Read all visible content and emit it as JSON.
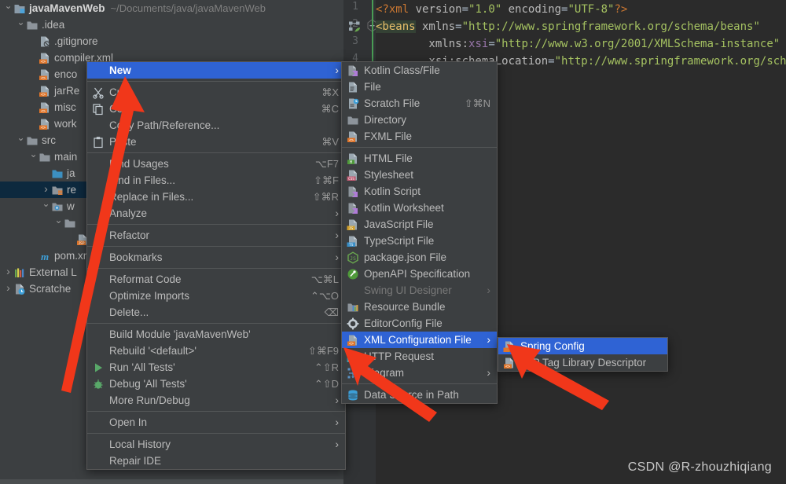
{
  "project_tree": {
    "rows": [
      {
        "indent": 0,
        "arrow": "down",
        "icon": "module-icon",
        "label": "javaMavenWeb",
        "bold": true,
        "path": "~/Documents/java/javaMavenWeb"
      },
      {
        "indent": 1,
        "arrow": "down",
        "icon": "folder-icon",
        "label": ".idea"
      },
      {
        "indent": 2,
        "arrow": "none",
        "icon": "gitignore-icon",
        "label": ".gitignore"
      },
      {
        "indent": 2,
        "arrow": "none",
        "icon": "xml-file-icon",
        "label": "compiler.xml"
      },
      {
        "indent": 2,
        "arrow": "none",
        "icon": "xml-file-icon",
        "label": "enco"
      },
      {
        "indent": 2,
        "arrow": "none",
        "icon": "xml-file-icon",
        "label": "jarRe"
      },
      {
        "indent": 2,
        "arrow": "none",
        "icon": "xml-file-icon",
        "label": "misc"
      },
      {
        "indent": 2,
        "arrow": "none",
        "icon": "xml-file-icon",
        "label": "work"
      },
      {
        "indent": 1,
        "arrow": "down",
        "icon": "folder-icon",
        "label": "src"
      },
      {
        "indent": 2,
        "arrow": "down",
        "icon": "folder-icon",
        "label": "main"
      },
      {
        "indent": 3,
        "arrow": "none",
        "icon": "source-folder-icon",
        "label": "ja"
      },
      {
        "indent": 3,
        "arrow": "right",
        "icon": "resource-folder-icon",
        "label": "re",
        "selected": true
      },
      {
        "indent": 3,
        "arrow": "down",
        "icon": "web-folder-icon",
        "label": "w"
      },
      {
        "indent": 4,
        "arrow": "down",
        "icon": "folder-icon",
        "label": ""
      },
      {
        "indent": 5,
        "arrow": "none",
        "icon": "jsp-file-icon",
        "label": ""
      },
      {
        "indent": 2,
        "arrow": "none",
        "icon": "maven-icon",
        "label": "pom.xm"
      },
      {
        "indent": 0,
        "arrow": "right",
        "icon": "external-libs-icon",
        "label": "External L"
      },
      {
        "indent": 0,
        "arrow": "right",
        "icon": "scratches-icon",
        "label": "Scratche"
      }
    ]
  },
  "editor": {
    "line_numbers": [
      "1",
      "2",
      "3",
      "4"
    ],
    "lines": [
      [
        {
          "t": "<?xml",
          "c": "pi"
        },
        {
          "t": " version",
          "c": "attr"
        },
        {
          "t": "=",
          "c": "eq"
        },
        {
          "t": "\"1.0\"",
          "c": "str"
        },
        {
          "t": " encoding",
          "c": "attr"
        },
        {
          "t": "=",
          "c": "eq"
        },
        {
          "t": "\"UTF-8\"",
          "c": "str"
        },
        {
          "t": "?>",
          "c": "pi"
        }
      ],
      [
        {
          "t": "<beans",
          "c": "tag-hl"
        },
        {
          "t": " xmlns",
          "c": "attr"
        },
        {
          "t": "=",
          "c": "eq"
        },
        {
          "t": "\"http://www.springframework.org/schema/beans\"",
          "c": "str"
        }
      ],
      [
        {
          "t": "        xmlns:",
          "c": "attr"
        },
        {
          "t": "xsi",
          "c": "ns"
        },
        {
          "t": "=",
          "c": "eq"
        },
        {
          "t": "\"http://www.w3.org/2001/XMLSchema-instance\"",
          "c": "str"
        }
      ],
      [
        {
          "t": "        xsi:schemaLocation",
          "c": "attr"
        },
        {
          "t": "=",
          "c": "eq"
        },
        {
          "t": "\"http://www.springframework.org/schema/bean",
          "c": "str"
        }
      ]
    ]
  },
  "context_menu": {
    "items": [
      {
        "type": "item",
        "label": "New",
        "icon": "",
        "shortcut": "",
        "submenu": true,
        "highlight": true,
        "bold": true
      },
      {
        "type": "sep"
      },
      {
        "type": "item",
        "label": "Cut",
        "icon": "cut-icon",
        "shortcut": "⌘X"
      },
      {
        "type": "item",
        "label": "Copy",
        "icon": "copy-icon",
        "shortcut": "⌘C"
      },
      {
        "type": "item",
        "label": "Copy Path/Reference...",
        "icon": "",
        "shortcut": ""
      },
      {
        "type": "item",
        "label": "Paste",
        "icon": "paste-icon",
        "shortcut": "⌘V"
      },
      {
        "type": "sep"
      },
      {
        "type": "item",
        "label": "Find Usages",
        "icon": "",
        "shortcut": "⌥F7"
      },
      {
        "type": "item",
        "label": "Find in Files...",
        "icon": "",
        "shortcut": "⇧⌘F"
      },
      {
        "type": "item",
        "label": "Replace in Files...",
        "icon": "",
        "shortcut": "⇧⌘R"
      },
      {
        "type": "item",
        "label": "Analyze",
        "icon": "",
        "shortcut": "",
        "submenu": true
      },
      {
        "type": "sep"
      },
      {
        "type": "item",
        "label": "Refactor",
        "icon": "",
        "shortcut": "",
        "submenu": true
      },
      {
        "type": "sep"
      },
      {
        "type": "item",
        "label": "Bookmarks",
        "icon": "",
        "shortcut": "",
        "submenu": true
      },
      {
        "type": "sep"
      },
      {
        "type": "item",
        "label": "Reformat Code",
        "icon": "",
        "shortcut": "⌥⌘L"
      },
      {
        "type": "item",
        "label": "Optimize Imports",
        "icon": "",
        "shortcut": "⌃⌥O"
      },
      {
        "type": "item",
        "label": "Delete...",
        "icon": "",
        "shortcut": "⌫"
      },
      {
        "type": "sep"
      },
      {
        "type": "item",
        "label": "Build Module 'javaMavenWeb'",
        "icon": "",
        "shortcut": ""
      },
      {
        "type": "item",
        "label": "Rebuild '<default>'",
        "icon": "",
        "shortcut": "⇧⌘F9"
      },
      {
        "type": "item",
        "label": "Run 'All Tests'",
        "icon": "run-icon",
        "shortcut": "⌃⇧R"
      },
      {
        "type": "item",
        "label": "Debug 'All Tests'",
        "icon": "debug-icon",
        "shortcut": "⌃⇧D"
      },
      {
        "type": "item",
        "label": "More Run/Debug",
        "icon": "",
        "shortcut": "",
        "submenu": true
      },
      {
        "type": "sep"
      },
      {
        "type": "item",
        "label": "Open In",
        "icon": "",
        "shortcut": "",
        "submenu": true
      },
      {
        "type": "sep"
      },
      {
        "type": "item",
        "label": "Local History",
        "icon": "",
        "shortcut": "",
        "submenu": true
      },
      {
        "type": "item",
        "label": "Repair IDE",
        "icon": "",
        "shortcut": ""
      }
    ]
  },
  "new_submenu": {
    "items": [
      {
        "type": "item",
        "label": "Kotlin Class/File",
        "icon": "kotlin-file-icon"
      },
      {
        "type": "item",
        "label": "File",
        "icon": "file-icon"
      },
      {
        "type": "item",
        "label": "Scratch File",
        "icon": "scratch-file-icon",
        "shortcut": "⇧⌘N"
      },
      {
        "type": "item",
        "label": "Directory",
        "icon": "folder-icon"
      },
      {
        "type": "item",
        "label": "FXML File",
        "icon": "fxml-file-icon"
      },
      {
        "type": "sep"
      },
      {
        "type": "item",
        "label": "HTML File",
        "icon": "html-file-icon"
      },
      {
        "type": "item",
        "label": "Stylesheet",
        "icon": "css-file-icon"
      },
      {
        "type": "item",
        "label": "Kotlin Script",
        "icon": "kotlin-file-icon"
      },
      {
        "type": "item",
        "label": "Kotlin Worksheet",
        "icon": "kotlin-file-icon"
      },
      {
        "type": "item",
        "label": "JavaScript File",
        "icon": "js-file-icon"
      },
      {
        "type": "item",
        "label": "TypeScript File",
        "icon": "ts-file-icon"
      },
      {
        "type": "item",
        "label": "package.json File",
        "icon": "node-icon"
      },
      {
        "type": "item",
        "label": "OpenAPI Specification",
        "icon": "openapi-icon"
      },
      {
        "type": "item",
        "label": "Swing UI Designer",
        "icon": "",
        "submenu": true,
        "disabled": true
      },
      {
        "type": "item",
        "label": "Resource Bundle",
        "icon": "resource-bundle-icon"
      },
      {
        "type": "item",
        "label": "EditorConfig File",
        "icon": "gear-icon"
      },
      {
        "type": "item",
        "label": "XML Configuration File",
        "icon": "xml-file-icon",
        "submenu": true,
        "highlight": true
      },
      {
        "type": "item",
        "label": "HTTP Request",
        "icon": "http-file-icon"
      },
      {
        "type": "item",
        "label": "Diagram",
        "icon": "diagram-icon",
        "submenu": true
      },
      {
        "type": "sep"
      },
      {
        "type": "item",
        "label": "Data Source in Path",
        "icon": "database-icon"
      }
    ]
  },
  "xml_submenu": {
    "items": [
      {
        "type": "item",
        "label": "Spring Config",
        "icon": "spring-file-icon",
        "highlight": true
      },
      {
        "type": "item",
        "label": "JSP Tag Library Descriptor",
        "icon": "xml-file-icon"
      }
    ]
  },
  "watermark": {
    "text": "CSDN @R-zhouzhiqiang"
  },
  "colors": {
    "menu_bg": "#3c3f41",
    "highlight_blue": "#2f63d4",
    "editor_bg": "#2b2b2b",
    "tree_selection": "#0d293e",
    "arrow_red": "#f1371a",
    "string_green": "#a5c261",
    "tag_yellow": "#e8bf6a"
  }
}
